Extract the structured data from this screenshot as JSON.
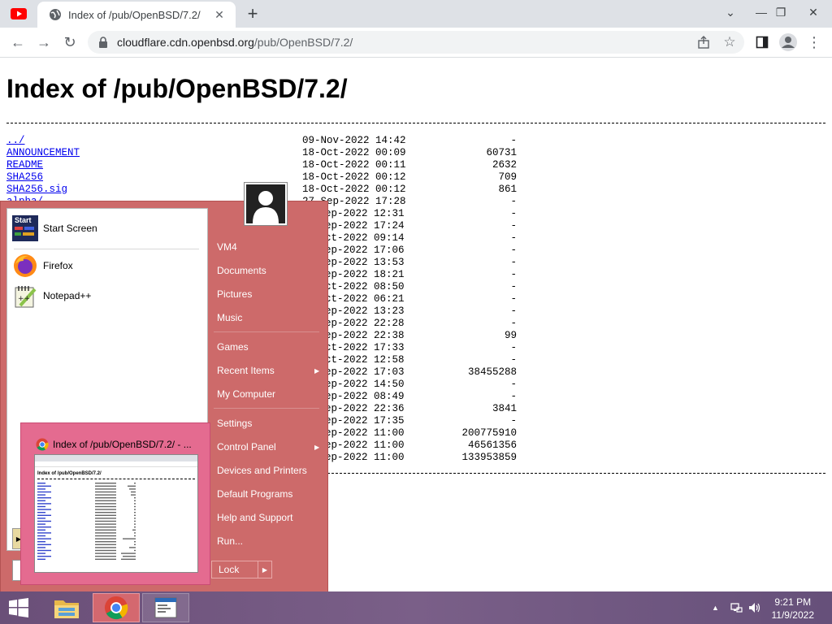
{
  "browser": {
    "tab_title": "Index of /pub/OpenBSD/7.2/",
    "url_host": "cloudflare.cdn.openbsd.org",
    "url_path": "/pub/OpenBSD/7.2/"
  },
  "page": {
    "heading": "Index of /pub/OpenBSD/7.2/",
    "entries": [
      {
        "name": "../",
        "date": "09-Nov-2022 14:42",
        "size": "-"
      },
      {
        "name": "ANNOUNCEMENT",
        "date": "18-Oct-2022 00:09",
        "size": "60731"
      },
      {
        "name": "README",
        "date": "18-Oct-2022 00:11",
        "size": "2632"
      },
      {
        "name": "SHA256",
        "date": "18-Oct-2022 00:12",
        "size": "709"
      },
      {
        "name": "SHA256.sig",
        "date": "18-Oct-2022 00:12",
        "size": "861"
      },
      {
        "name": "alpha/",
        "date": "27-Sep-2022 17:28",
        "size": "-"
      },
      {
        "name": "",
        "date": "ep-2022 12:31",
        "size": "-"
      },
      {
        "name": "",
        "date": "ep-2022 17:24",
        "size": "-"
      },
      {
        "name": "",
        "date": "ct-2022 09:14",
        "size": "-"
      },
      {
        "name": "",
        "date": "ep-2022 17:06",
        "size": "-"
      },
      {
        "name": "",
        "date": "ep-2022 13:53",
        "size": "-"
      },
      {
        "name": "",
        "date": "ep-2022 18:21",
        "size": "-"
      },
      {
        "name": "",
        "date": "ct-2022 08:50",
        "size": "-"
      },
      {
        "name": "",
        "date": "ct-2022 06:21",
        "size": "-"
      },
      {
        "name": "",
        "date": "ep-2022 13:23",
        "size": "-"
      },
      {
        "name": "",
        "date": "ep-2022 22:28",
        "size": "-"
      },
      {
        "name": "",
        "date": "ep-2022 22:38",
        "size": "99"
      },
      {
        "name": "",
        "date": "ct-2022 17:33",
        "size": "-"
      },
      {
        "name": "",
        "date": "ct-2022 12:58",
        "size": "-"
      },
      {
        "name": "",
        "date": "ep-2022 17:03",
        "size": "38455288"
      },
      {
        "name": "",
        "date": "ep-2022 14:50",
        "size": "-"
      },
      {
        "name": "",
        "date": "ep-2022 08:49",
        "size": "-"
      },
      {
        "name": "",
        "date": "ep-2022 22:36",
        "size": "3841"
      },
      {
        "name": "",
        "date": "ep-2022 17:35",
        "size": "-"
      },
      {
        "name": "",
        "date": "ep-2022 11:00",
        "size": "200775910"
      },
      {
        "name": "",
        "date": "ep-2022 11:00",
        "size": "46561356"
      },
      {
        "name": "",
        "date": "ep-2022 11:00",
        "size": "133953859"
      }
    ]
  },
  "start_menu": {
    "programs": [
      {
        "label": "Start Screen",
        "icon": "start-screen-icon"
      },
      {
        "label": "Firefox",
        "icon": "firefox-icon"
      },
      {
        "label": "Notepad++",
        "icon": "notepadpp-icon"
      }
    ],
    "right": {
      "vm4": "VM4",
      "documents": "Documents",
      "pictures": "Pictures",
      "music": "Music",
      "games": "Games",
      "recent_items": "Recent Items",
      "my_computer": "My Computer",
      "settings": "Settings",
      "control_panel": "Control Panel",
      "devices_printers": "Devices and Printers",
      "default_programs": "Default Programs",
      "help_support": "Help and Support",
      "run": "Run..."
    },
    "lock": "Lock",
    "start_icon_text": "Start"
  },
  "preview": {
    "title": "Index of /pub/OpenBSD/7.2/ - ...",
    "mini_heading": "Index of /pub/OpenBSD/7.2/"
  },
  "taskbar": {
    "time": "9:21 PM",
    "date": "11/9/2022"
  },
  "colors": {
    "start_menu_bg": "#cd6a6a",
    "preview_bg": "#e46b90",
    "taskbar": "#6a4f78",
    "link": "#0000ee"
  }
}
